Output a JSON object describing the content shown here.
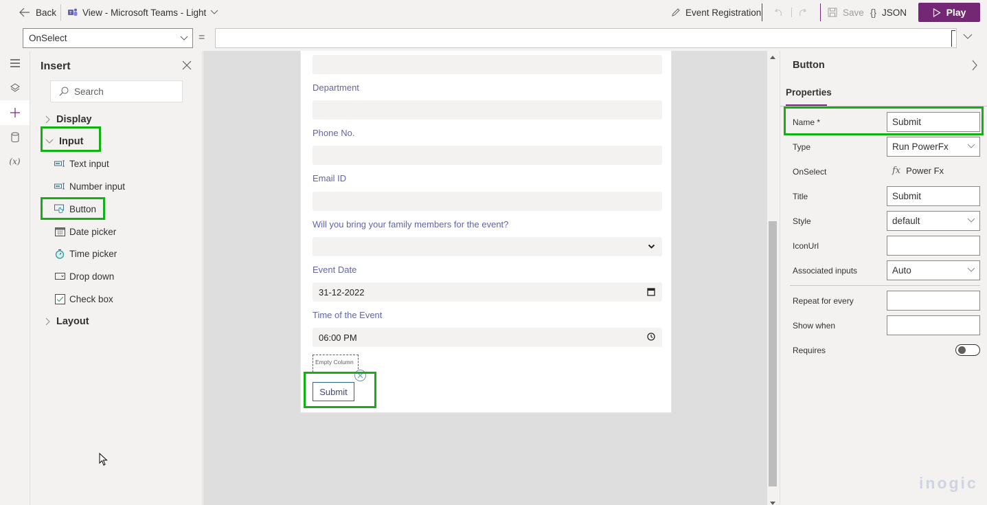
{
  "topbar": {
    "back_label": "Back",
    "view_label": "View - Microsoft Teams - Light",
    "app_name": "Event Registration",
    "save_label": "Save",
    "json_label": "JSON",
    "play_label": "Play",
    "icons": {
      "back": "arrow-left-icon",
      "teams": "teams-icon",
      "view_dropdown": "chevron-down-icon",
      "edit": "pencil-icon",
      "undo": "undo-icon",
      "redo": "redo-icon",
      "save": "floppy-disk-icon",
      "json": "curly-braces-icon",
      "play": "play-icon"
    },
    "accent_color": "#742774"
  },
  "formula_bar": {
    "property": "OnSelect",
    "equals": "=",
    "formula": ""
  },
  "rail": {
    "items": [
      {
        "name": "menu",
        "icon": "hamburger-icon"
      },
      {
        "name": "tree-view",
        "icon": "layers-icon"
      },
      {
        "name": "insert",
        "icon": "plus-icon",
        "active": true
      },
      {
        "name": "data",
        "icon": "database-icon"
      },
      {
        "name": "variables",
        "icon": "variable-icon",
        "glyph": "(x)"
      }
    ]
  },
  "insert_panel": {
    "title": "Insert",
    "search_placeholder": "Search",
    "categories": [
      {
        "label": "Display",
        "expanded": false
      },
      {
        "label": "Input",
        "expanded": true,
        "highlighted": true
      },
      {
        "label": "Layout",
        "expanded": false
      }
    ],
    "input_controls": [
      {
        "label": "Text input",
        "icon": "text-input-icon"
      },
      {
        "label": "Number input",
        "icon": "number-input-icon"
      },
      {
        "label": "Button",
        "icon": "button-icon",
        "highlighted": true
      },
      {
        "label": "Date picker",
        "icon": "calendar-icon"
      },
      {
        "label": "Time picker",
        "icon": "stopwatch-icon"
      },
      {
        "label": "Drop down",
        "icon": "dropdown-icon"
      },
      {
        "label": "Check box",
        "icon": "checkbox-icon"
      }
    ]
  },
  "form": {
    "fields": [
      {
        "label": "",
        "type": "text",
        "value": ""
      },
      {
        "label": "Department",
        "type": "text",
        "value": ""
      },
      {
        "label": "Phone No.",
        "type": "text",
        "value": ""
      },
      {
        "label": "Email ID",
        "type": "text",
        "value": ""
      },
      {
        "label": "Will you bring your family members for the event?",
        "type": "select",
        "value": ""
      },
      {
        "label": "Event Date",
        "type": "date",
        "value": "31-12-2022"
      },
      {
        "label": "Time of the Event",
        "type": "time",
        "value": "06:00 PM"
      }
    ],
    "empty_column_label": "Empty Column",
    "submit_label": "Submit"
  },
  "properties_panel": {
    "title": "Button",
    "tab": "Properties",
    "rows": [
      {
        "label": "Name *",
        "kind": "text",
        "value": "Submit",
        "highlighted": true
      },
      {
        "label": "Type",
        "kind": "select",
        "value": "Run PowerFx"
      },
      {
        "label": "OnSelect",
        "kind": "fx",
        "value": "Power Fx"
      },
      {
        "label": "Title",
        "kind": "text",
        "value": "Submit"
      },
      {
        "label": "Style",
        "kind": "select",
        "value": "default"
      },
      {
        "label": "IconUrl",
        "kind": "text",
        "value": ""
      },
      {
        "label": "Associated inputs",
        "kind": "select",
        "value": "Auto"
      },
      {
        "label": "Repeat for every",
        "kind": "text",
        "value": ""
      },
      {
        "label": "Show when",
        "kind": "text",
        "value": ""
      },
      {
        "label": "Requires",
        "kind": "toggle",
        "value": false
      }
    ],
    "fx_glyph": "fx"
  },
  "watermark": "inogic",
  "highlight_color": "#12b012"
}
